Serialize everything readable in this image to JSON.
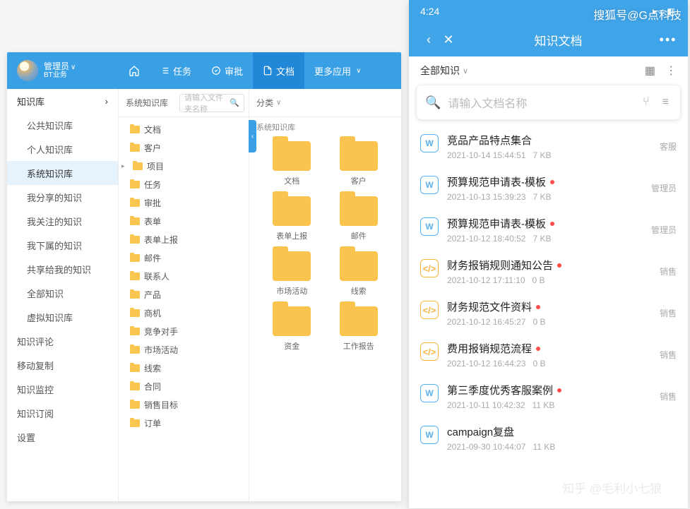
{
  "watermarks": {
    "tr": "搜狐号@G点科技",
    "br": "知乎 @毛利小七狼"
  },
  "desktop": {
    "user": {
      "name": "管理员",
      "sub": "BT业务"
    },
    "nav": {
      "home": "",
      "tasks": "任务",
      "approval": "审批",
      "docs": "文档",
      "more": "更多应用"
    },
    "sidebar": {
      "header": "知识库",
      "items": [
        "公共知识库",
        "个人知识库",
        "系统知识库",
        "我分享的知识",
        "我关注的知识",
        "我下属的知识",
        "共享给我的知识",
        "全部知识",
        "虚拟知识库"
      ],
      "selectedIndex": 2,
      "sections": [
        "知识评论",
        "移动复制",
        "知识监控",
        "知识订阅",
        "设置"
      ]
    },
    "tree": {
      "title": "系统知识库",
      "searchPlaceholder": "请输入文件夹名称",
      "items": [
        "文档",
        "客户",
        "项目",
        "任务",
        "审批",
        "表单",
        "表单上报",
        "邮件",
        "联系人",
        "产品",
        "商机",
        "竞争对手",
        "市场活动",
        "线索",
        "合同",
        "销售目标",
        "订单"
      ],
      "expanded": "项目"
    },
    "grid": {
      "category": "分类",
      "sub": "系统知识库",
      "folders": [
        "文档",
        "客户",
        "表单上报",
        "邮件",
        "市场活动",
        "线索",
        "资金",
        "工作报告"
      ]
    }
  },
  "mobile": {
    "status": {
      "time": "4:24"
    },
    "header": {
      "title": "知识文档"
    },
    "filter": {
      "label": "全部知识"
    },
    "search": {
      "placeholder": "请输入文档名称"
    },
    "items": [
      {
        "icon": "w",
        "title": "竞品产品特点集合",
        "dot": false,
        "date": "2021-10-14 15:44:51",
        "size": "7 KB",
        "owner": "客服"
      },
      {
        "icon": "w",
        "title": "预算规范申请表-模板",
        "dot": true,
        "date": "2021-10-13 15:39:23",
        "size": "7 KB",
        "owner": "管理员"
      },
      {
        "icon": "w",
        "title": "预算规范申请表-模板",
        "dot": true,
        "date": "2021-10-12 18:40:52",
        "size": "7 KB",
        "owner": "管理员"
      },
      {
        "icon": "c",
        "title": "财务报销规则通知公告",
        "dot": true,
        "date": "2021-10-12 17:11:10",
        "size": "0 B",
        "owner": "销售"
      },
      {
        "icon": "c",
        "title": "财务规范文件资料",
        "dot": true,
        "date": "2021-10-12 16:45:27",
        "size": "0 B",
        "owner": "销售"
      },
      {
        "icon": "c",
        "title": "费用报销规范流程",
        "dot": true,
        "date": "2021-10-12 16:44:23",
        "size": "0 B",
        "owner": "销售"
      },
      {
        "icon": "w",
        "title": "第三季度优秀客服案例",
        "dot": true,
        "date": "2021-10-11 10:42:32",
        "size": "11 KB",
        "owner": "销售"
      },
      {
        "icon": "w",
        "title": "campaign复盘",
        "dot": false,
        "date": "2021-09-30 10:44:07",
        "size": "11 KB",
        "owner": ""
      }
    ]
  }
}
